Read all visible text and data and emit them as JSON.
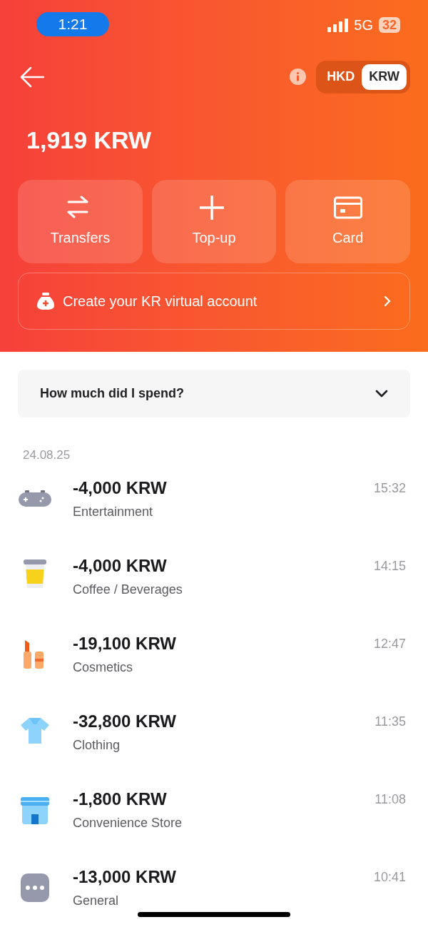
{
  "status_bar": {
    "time": "1:21",
    "network": "5G",
    "battery": "32"
  },
  "currency_toggle": [
    {
      "label": "HKD",
      "selected": false
    },
    {
      "label": "KRW",
      "selected": true
    }
  ],
  "balance": "1,919 KRW",
  "actions": [
    {
      "label": "Transfers",
      "kind": "transfer"
    },
    {
      "label": "Top-up",
      "kind": "plus"
    },
    {
      "label": "Card",
      "kind": "card"
    }
  ],
  "virtual_account": {
    "label": "Create your KR virtual account"
  },
  "spending": {
    "label": "How much did I spend?",
    "expanded": false
  },
  "date": "24.08.25",
  "transactions": [
    {
      "amount": "-4,000 KRW",
      "category": "Entertainment",
      "time": "15:32",
      "kind": "game"
    },
    {
      "amount": "-4,000 KRW",
      "category": "Coffee / Beverages",
      "time": "14:15",
      "kind": "coffee"
    },
    {
      "amount": "-19,100 KRW",
      "category": "Cosmetics",
      "time": "12:47",
      "kind": "cosmetics"
    },
    {
      "amount": "-32,800 KRW",
      "category": "Clothing",
      "time": "11:35",
      "kind": "clothing"
    },
    {
      "amount": "-1,800 KRW",
      "category": "Convenience Store",
      "time": "11:08",
      "kind": "store"
    },
    {
      "amount": "-13,000 KRW",
      "category": "General",
      "time": "10:41",
      "kind": "general"
    }
  ]
}
